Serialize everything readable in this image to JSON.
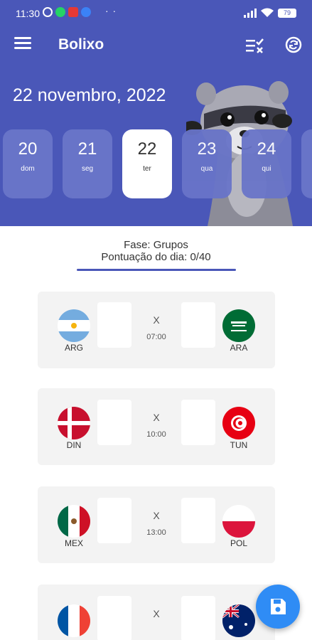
{
  "status": {
    "time": "11:30",
    "dots": "· ·",
    "battery": "79"
  },
  "app": {
    "title": "Bolixo"
  },
  "date_heading": "22 novembro, 2022",
  "days": [
    {
      "num": "20",
      "name": "dom"
    },
    {
      "num": "21",
      "name": "seg"
    },
    {
      "num": "22",
      "name": "ter",
      "selected": true
    },
    {
      "num": "23",
      "name": "qua"
    },
    {
      "num": "24",
      "name": "qui"
    }
  ],
  "phase": "Fase: Grupos",
  "points": "Pontuação do dia: 0/40",
  "matches": [
    {
      "home": "ARG",
      "away": "ARA",
      "vs": "X",
      "time": "07:00"
    },
    {
      "home": "DIN",
      "away": "TUN",
      "vs": "X",
      "time": "10:00"
    },
    {
      "home": "MEX",
      "away": "POL",
      "vs": "X",
      "time": "13:00"
    },
    {
      "home": "",
      "away": "",
      "vs": "X",
      "time": ""
    }
  ],
  "colors": {
    "primary": "#4a57b8",
    "day_card": "#6874c8",
    "fab": "#2f8cf5",
    "card_bg": "#f3f3f3"
  },
  "icons": {
    "menu": "hamburger-icon",
    "checklist": "checklist-icon",
    "sync": "sync-icon",
    "fab": "save-icon"
  }
}
